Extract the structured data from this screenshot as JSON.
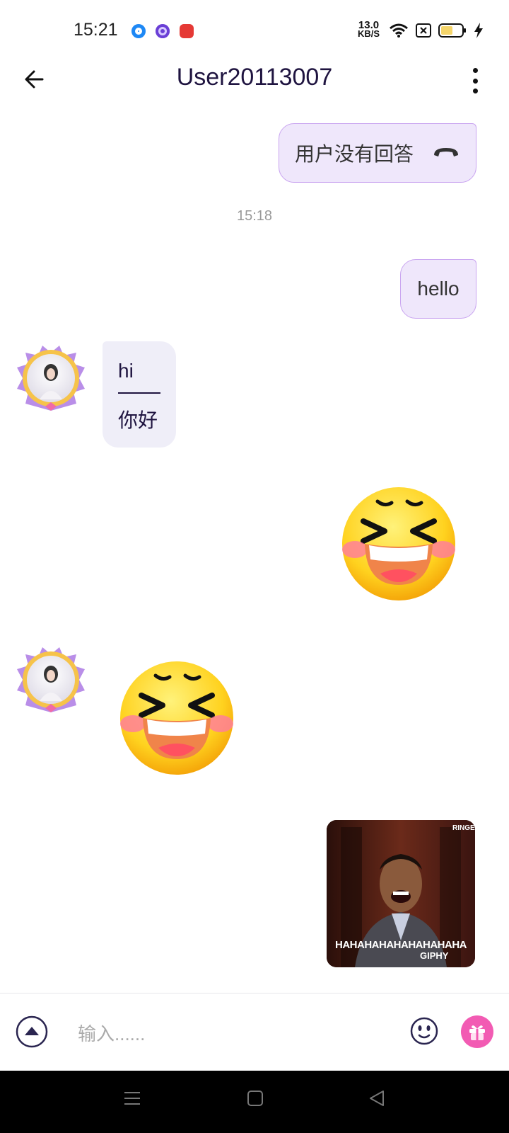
{
  "status_bar": {
    "time": "15:21",
    "net_speed_value": "13.0",
    "net_speed_unit": "KB/S",
    "icons": [
      "blue-app-icon",
      "purple-app-icon",
      "baidu-icon",
      "wifi-icon",
      "sim-off-icon",
      "battery-icon",
      "charging-icon"
    ]
  },
  "header": {
    "title": "User20113007",
    "back_icon": "arrow-left-icon",
    "more_icon": "more-vertical-icon"
  },
  "messages": [
    {
      "type": "call",
      "direction": "out",
      "text": "用户没有回答",
      "icon": "phone-hangup-icon"
    },
    {
      "type": "timestamp",
      "text": "15:18"
    },
    {
      "type": "text",
      "direction": "out",
      "text": "hello"
    },
    {
      "type": "text",
      "direction": "in",
      "text": "hi",
      "translation": "你好"
    },
    {
      "type": "emoji",
      "direction": "out",
      "emoji": "laughing-emoji"
    },
    {
      "type": "emoji",
      "direction": "in",
      "emoji": "laughing-emoji"
    },
    {
      "type": "gif",
      "direction": "out",
      "caption": "HAHAHAHAHAHAHAHAHA",
      "watermark": "GIPHY",
      "channel": "RINGER"
    }
  ],
  "input_bar": {
    "placeholder": "输入......",
    "expand_icon": "chevron-up-circle-icon",
    "emoji_icon": "smiley-icon",
    "gift_icon": "gift-icon"
  },
  "colors": {
    "outgoing_bubble": "#efe7fb",
    "outgoing_border": "#c9a4f0",
    "incoming_bubble": "#efeef8",
    "title": "#1f1440",
    "gift": "#f25bb3"
  }
}
